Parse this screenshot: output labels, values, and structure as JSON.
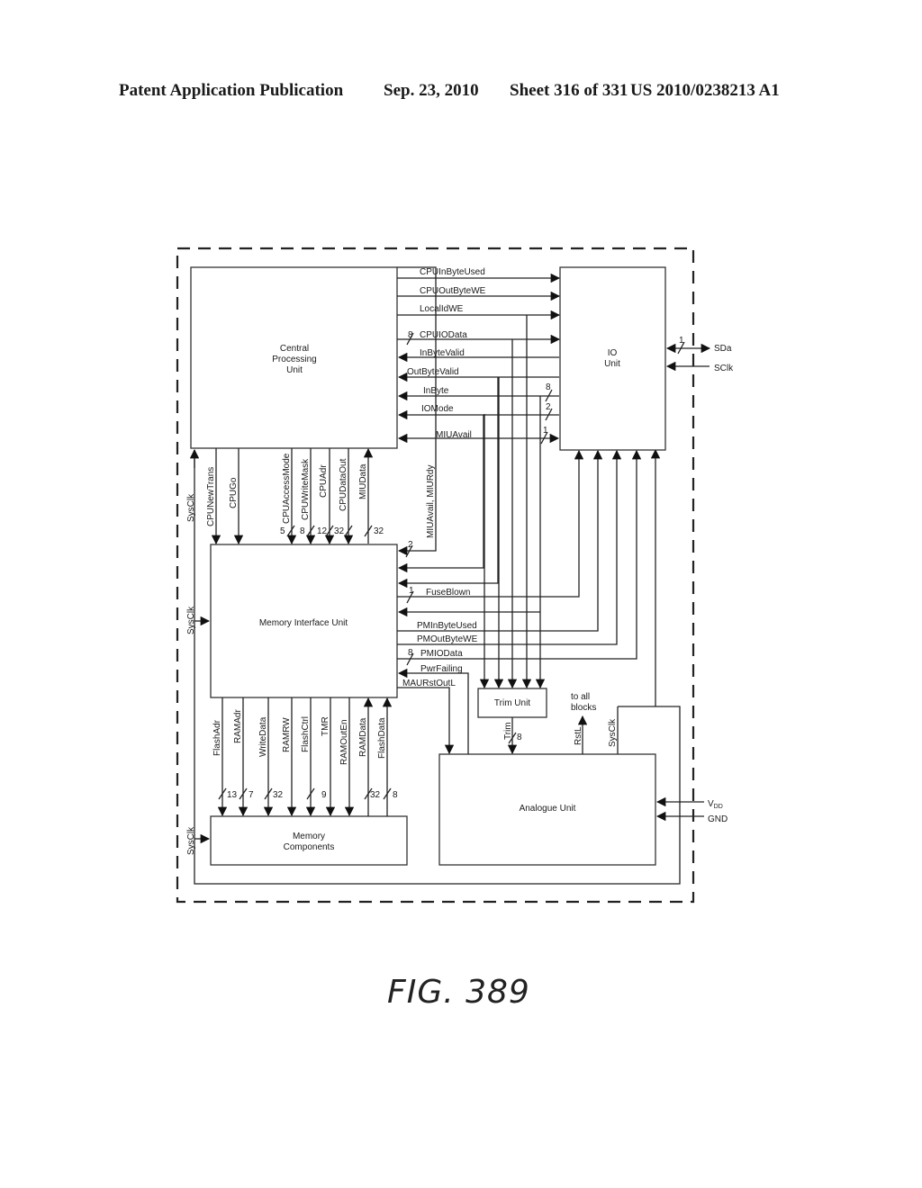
{
  "header": {
    "publication": "Patent Application Publication",
    "date": "Sep. 23, 2010",
    "sheet": "Sheet 316 of 331",
    "number": "US 2010/0238213 A1"
  },
  "blocks": {
    "cpu": [
      "Central",
      "Processing",
      "Unit"
    ],
    "io": [
      "IO",
      "Unit"
    ],
    "miu": [
      "Memory Interface Unit"
    ],
    "trim": [
      "Trim Unit"
    ],
    "analogue": [
      "Analogue Unit"
    ],
    "memory": [
      "Memory",
      "Components"
    ]
  },
  "cpu_io_signals": [
    {
      "name": "CPUInByteUsed",
      "dir": "to-io",
      "width": ""
    },
    {
      "name": "CPUOutByteWE",
      "dir": "to-io",
      "width": ""
    },
    {
      "name": "LocalIdWE",
      "dir": "to-io",
      "width": ""
    },
    {
      "name": "CPUIOData",
      "dir": "to-io",
      "width": "8"
    },
    {
      "name": "InByteValid",
      "dir": "to-cpu",
      "width": ""
    },
    {
      "name": "OutByteValid",
      "dir": "to-cpu",
      "width": ""
    },
    {
      "name": "InByte",
      "dir": "to-cpu",
      "width": "8"
    },
    {
      "name": "IOMode",
      "dir": "to-cpu",
      "width": "2"
    },
    {
      "name": "MIUAvail",
      "dir": "bidirectional",
      "width": "1"
    }
  ],
  "io_external": [
    {
      "name": "SDa",
      "dir": "bidirectional",
      "width": "1"
    },
    {
      "name": "SClk",
      "dir": "input",
      "width": ""
    }
  ],
  "cpu_miu_signals": [
    {
      "name": "CPUNewTrans",
      "dir": "down",
      "width": ""
    },
    {
      "name": "CPUGo",
      "dir": "down",
      "width": ""
    },
    {
      "name": "CPUAccessMode",
      "dir": "down",
      "width": "5"
    },
    {
      "name": "CPUWriteMask",
      "dir": "down",
      "width": "8"
    },
    {
      "name": "CPUAdr",
      "dir": "down",
      "width": "12"
    },
    {
      "name": "CPUDataOut",
      "dir": "down",
      "width": "32"
    },
    {
      "name": "MIUData",
      "dir": "up",
      "width": "32"
    }
  ],
  "miu_right_signals": [
    {
      "name": "MIUAvail, MIURdy",
      "width": "2"
    },
    {
      "name": "FuseBlown",
      "width": "1"
    },
    {
      "name": "PMInByteUsed",
      "width": ""
    },
    {
      "name": "PMOutByteWE",
      "width": ""
    },
    {
      "name": "PMIOData",
      "width": "8"
    },
    {
      "name": "PwrFailing",
      "width": ""
    },
    {
      "name": "MAURstOutL",
      "width": ""
    }
  ],
  "miu_memory_signals": [
    {
      "name": "FlashAdr",
      "dir": "down",
      "width": "13"
    },
    {
      "name": "RAMAdr",
      "dir": "down",
      "width": "7"
    },
    {
      "name": "WriteData",
      "dir": "down",
      "width": "32"
    },
    {
      "name": "RAMRW",
      "dir": "down",
      "width": ""
    },
    {
      "name": "FlashCtrl",
      "dir": "down",
      "width": "9"
    },
    {
      "name": "TMR",
      "dir": "down",
      "width": ""
    },
    {
      "name": "RAMOutEn",
      "dir": "down",
      "width": ""
    },
    {
      "name": "RAMData",
      "dir": "up",
      "width": "32"
    },
    {
      "name": "FlashData",
      "dir": "up",
      "width": "8"
    }
  ],
  "analogue_signals": {
    "trim": {
      "name": "Trim",
      "width": "8"
    },
    "rstl": "RstL",
    "rstl_note": [
      "to all",
      "blocks"
    ],
    "sysclk": "SysClk",
    "vdd": "V",
    "vdd_sub": "DD",
    "gnd": "GND"
  },
  "sysclk_label": "SysClk",
  "figure_caption": "FIG. 389"
}
